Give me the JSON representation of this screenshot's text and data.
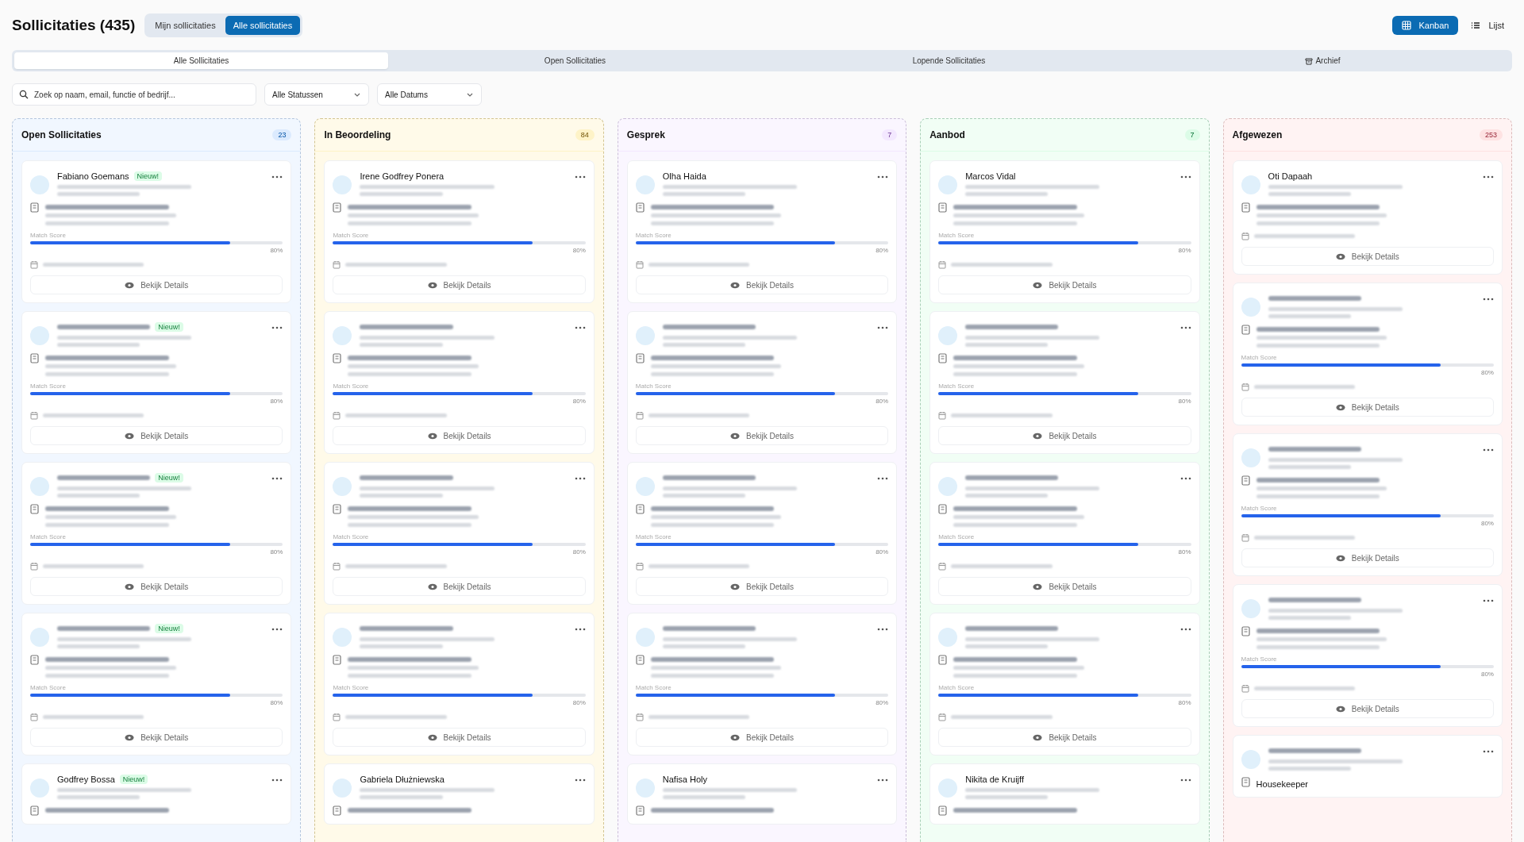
{
  "title": "Sollicitaties (435)",
  "scope_toggle": [
    {
      "label": "Mijn sollicitaties",
      "selected": false
    },
    {
      "label": "Alle sollicitaties",
      "selected": true
    }
  ],
  "view_toggle": [
    {
      "label": "Kanban",
      "kind": "grid",
      "selected": true
    },
    {
      "label": "Lijst",
      "kind": "list",
      "selected": false
    }
  ],
  "tabs": [
    {
      "label": "Alle Sollicitaties",
      "selected": true
    },
    {
      "label": "Open Sollicitaties",
      "selected": false
    },
    {
      "label": "Lopende Sollicitaties",
      "selected": false
    },
    {
      "label": "Archief",
      "icon": true,
      "selected": false
    }
  ],
  "search": {
    "placeholder": "Zoek op naam, email, functie of bedrijf..."
  },
  "filters": [
    {
      "value": "Alle Statussen"
    },
    {
      "value": "Alle Datums"
    }
  ],
  "columns": [
    {
      "title": "Open Sollicitaties",
      "count": "23",
      "color": "#dbeafe",
      "cards": [
        {
          "name": "Fabiano Goemans",
          "badge": "Nieuw!",
          "match_label": "Match Score",
          "level": 0.79,
          "score": "80%",
          "button": "Bekijk Details"
        },
        {
          "badge": "Nieuw!",
          "match_label": "Match Score",
          "level": 0.79,
          "score": "80%",
          "button": "Bekijk Details"
        },
        {
          "badge": "Nieuw!",
          "match_label": "Match Score",
          "level": 0.79,
          "score": "80%",
          "button": "Bekijk Details"
        },
        {
          "badge": "Nieuw!",
          "match_label": "Match Score",
          "level": 0.79,
          "score": "80%",
          "button": "Bekijk Details"
        },
        {
          "name": "Godfrey Bossa",
          "badge": "Nieuw!",
          "partial": true
        }
      ]
    },
    {
      "title": "In Beoordeling",
      "count": "84",
      "color": "#fef3c7",
      "cards": [
        {
          "name": "Irene Godfrey Ponera",
          "match_label": "Match Score",
          "level": 0.79,
          "score": "80%",
          "button": "Bekijk Details"
        },
        {
          "match_label": "Match Score",
          "level": 0.79,
          "score": "80%",
          "button": "Bekijk Details"
        },
        {
          "match_label": "Match Score",
          "level": 0.79,
          "score": "80%",
          "button": "Bekijk Details"
        },
        {
          "match_label": "Match Score",
          "level": 0.79,
          "score": "80%",
          "button": "Bekijk Details"
        },
        {
          "name": "Gabriela Dłużniewska",
          "partial": true
        }
      ]
    },
    {
      "title": "Gesprek",
      "count": "7",
      "color": "#f3e8ff",
      "cards": [
        {
          "name": "Olha Haida",
          "match_label": "Match Score",
          "level": 0.79,
          "score": "80%",
          "button": "Bekijk Details"
        },
        {
          "match_label": "Match Score",
          "level": 0.79,
          "score": "80%",
          "button": "Bekijk Details"
        },
        {
          "match_label": "Match Score",
          "level": 0.79,
          "score": "80%",
          "button": "Bekijk Details"
        },
        {
          "match_label": "Match Score",
          "level": 0.79,
          "score": "80%",
          "button": "Bekijk Details"
        },
        {
          "name": "Nafisa Holy",
          "partial": true
        }
      ]
    },
    {
      "title": "Aanbod",
      "count": "7",
      "color": "#dcfce7",
      "cards": [
        {
          "name": "Marcos Vidal",
          "match_label": "Match Score",
          "level": 0.79,
          "score": "80%",
          "button": "Bekijk Details"
        },
        {
          "match_label": "Match Score",
          "level": 0.79,
          "score": "80%",
          "button": "Bekijk Details"
        },
        {
          "match_label": "Match Score",
          "level": 0.79,
          "score": "80%",
          "button": "Bekijk Details"
        },
        {
          "match_label": "Match Score",
          "level": 0.79,
          "score": "80%",
          "button": "Bekijk Details"
        },
        {
          "name": "Nikita de Kruijff",
          "partial": true
        }
      ]
    },
    {
      "title": "Afgewezen",
      "count": "253",
      "color": "#fee2e2",
      "cards": [
        {
          "name": "Oti Dapaah",
          "button": "Bekijk Details"
        },
        {
          "match_label": "Match Score",
          "level": 0.79,
          "score": "80%",
          "button": "Bekijk Details"
        },
        {
          "match_label": "Match Score",
          "level": 0.79,
          "score": "80%",
          "button": "Bekijk Details"
        },
        {
          "match_label": "Match Score",
          "level": 0.79,
          "score": "80%",
          "button": "Bekijk Details"
        },
        {
          "job": "Housekeeper",
          "partial": true
        }
      ]
    }
  ]
}
